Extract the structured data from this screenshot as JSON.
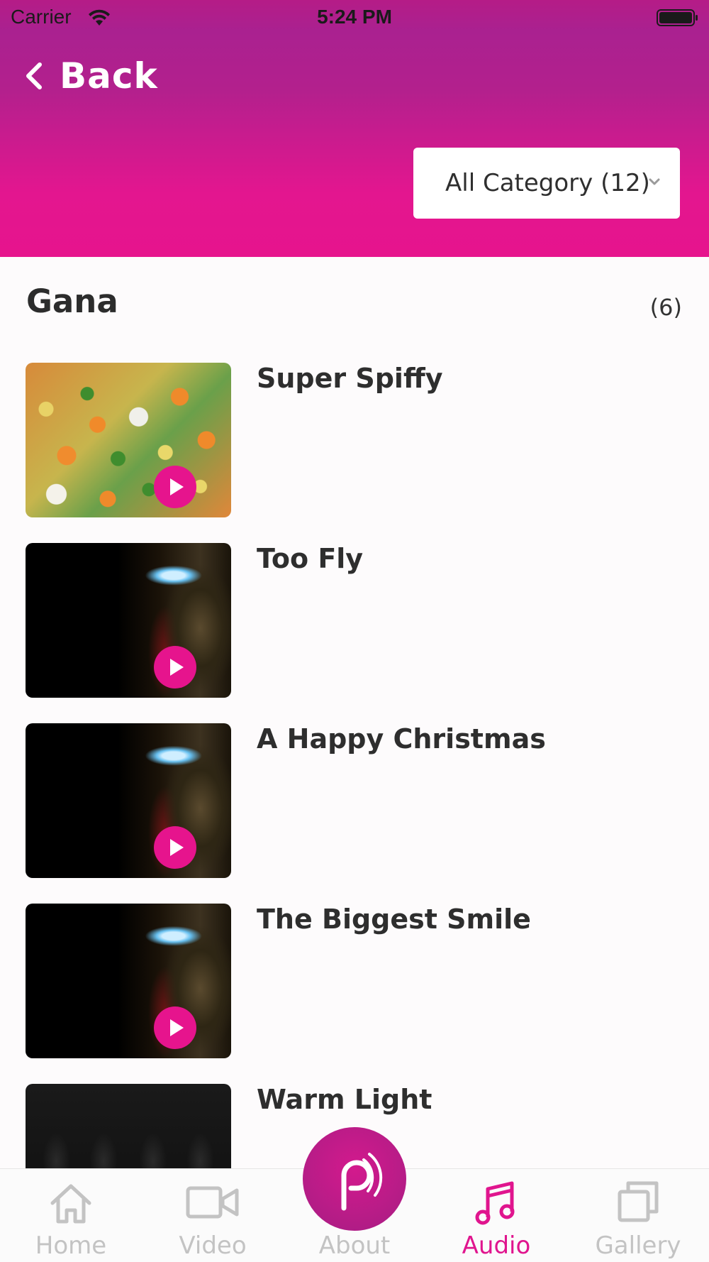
{
  "status_bar": {
    "carrier": "Carrier",
    "time": "5:24 PM"
  },
  "header": {
    "back_label": "Back",
    "category_select": "All Category (12)"
  },
  "section": {
    "title": "Gana",
    "count": "(6)"
  },
  "items": [
    {
      "title": "Super Spiffy",
      "thumbnail": "vegetables"
    },
    {
      "title": "Too Fly",
      "thumbnail": "iron-man-helmet"
    },
    {
      "title": "A Happy Christmas",
      "thumbnail": "iron-man-helmet"
    },
    {
      "title": "The Biggest Smile",
      "thumbnail": "iron-man-helmet"
    },
    {
      "title": "Warm Light",
      "thumbnail": "hoodies"
    }
  ],
  "tabbar": {
    "tabs": [
      {
        "label": "Home",
        "icon": "home-icon",
        "active": false
      },
      {
        "label": "Video",
        "icon": "video-icon",
        "active": false
      },
      {
        "label": "About",
        "icon": "podcast-logo-icon",
        "active": false
      },
      {
        "label": "Audio",
        "icon": "music-note-icon",
        "active": true
      },
      {
        "label": "Gallery",
        "icon": "gallery-icon",
        "active": false
      }
    ]
  },
  "colors": {
    "accent": "#e6148d",
    "header_top": "#aa2190",
    "tab_inactive": "#c3c3c3"
  }
}
